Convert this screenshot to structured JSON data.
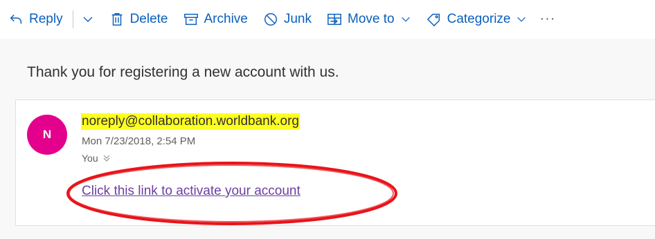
{
  "toolbar": {
    "reply_label": "Reply",
    "delete_label": "Delete",
    "archive_label": "Archive",
    "junk_label": "Junk",
    "move_to_label": "Move to",
    "categorize_label": "Categorize",
    "more_label": "···",
    "icons": {
      "reply": "reply-arrow-icon",
      "reply_dropdown": "chevron-down-icon",
      "delete": "trash-icon",
      "archive": "archive-box-icon",
      "junk": "block-icon",
      "move_to": "move-folder-icon",
      "categorize": "tag-icon"
    }
  },
  "message": {
    "subject": "Thank you for registering a new account with us.",
    "avatar_initial": "N",
    "avatar_color": "#e3008c",
    "sender": "noreply@collaboration.worldbank.org",
    "date": "Mon 7/23/2018, 2:54 PM",
    "to": "You",
    "link_text": "Click this link to activate your account"
  },
  "colors": {
    "accent": "#0a5fbd",
    "highlight": "#ffff20",
    "link_visited": "#6b3fa0",
    "annotation": "#e8141a"
  }
}
